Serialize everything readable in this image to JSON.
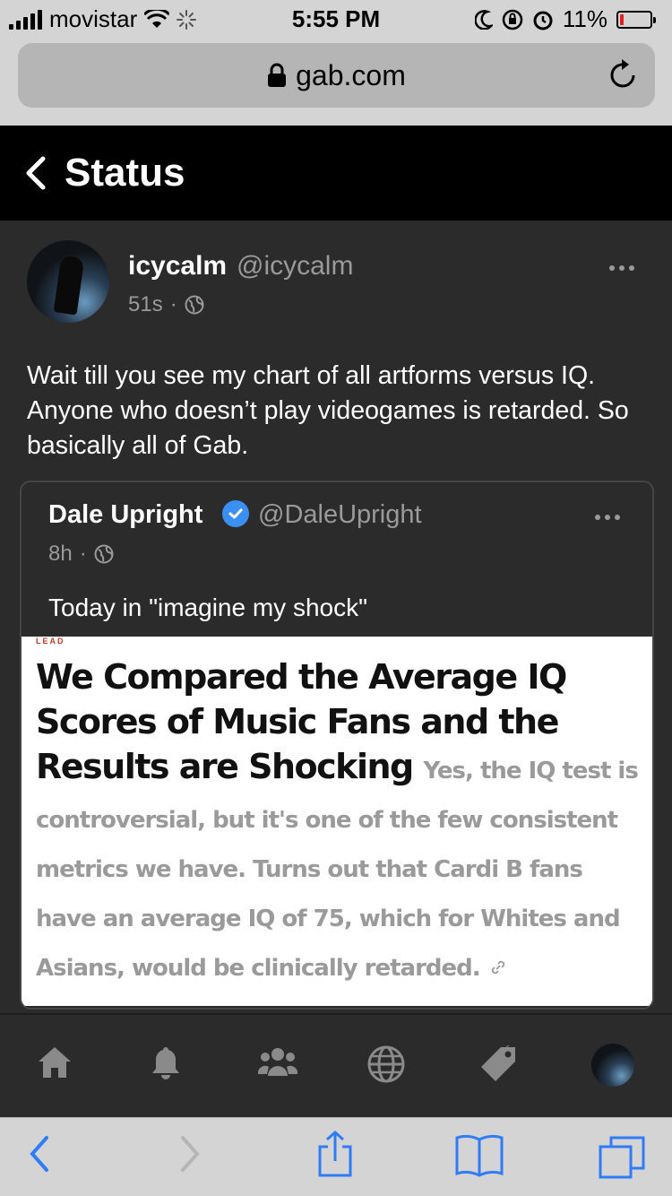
{
  "status_bar": {
    "carrier": "movistar",
    "time": "5:55 PM",
    "battery": "11%",
    "battery_level": 0.11,
    "battery_color": "#e0201e"
  },
  "browser": {
    "url": "gab.com"
  },
  "header": {
    "title": "Status"
  },
  "post": {
    "display_name": "icycalm",
    "handle": "@icycalm",
    "age": "51s",
    "separator": "·",
    "text": "Wait till you see my chart of all artforms versus IQ. Anyone who doesn’t play videogames is retarded. So basically all of Gab."
  },
  "quoted_post": {
    "display_name": "Dale Upright",
    "handle": "@DaleUpright",
    "verified": true,
    "verified_color": "#3b8ff0",
    "age": "8h",
    "separator": "·",
    "text": "Today in \"imagine my shock\"",
    "image": {
      "tag": "LEAD",
      "headline": "We Compared the Average IQ Scores of Music Fans and the Results are Shocking",
      "subtext": "Yes, the IQ test is controversial, but it's one of the few consistent metrics we have. Turns out that Cardi B fans have an average IQ of 75, which for Whites and Asians, would be clinically retarded."
    }
  },
  "bottom_nav": {
    "items": [
      "home-icon",
      "bell-icon",
      "users-icon",
      "globe-icon",
      "tag-icon",
      "profile-avatar"
    ]
  },
  "safari_toolbar": {
    "items": [
      "back-arrow-icon",
      "forward-arrow-icon",
      "share-icon",
      "bookmarks-icon",
      "tabs-icon"
    ],
    "accent": "#2f7cf6"
  }
}
